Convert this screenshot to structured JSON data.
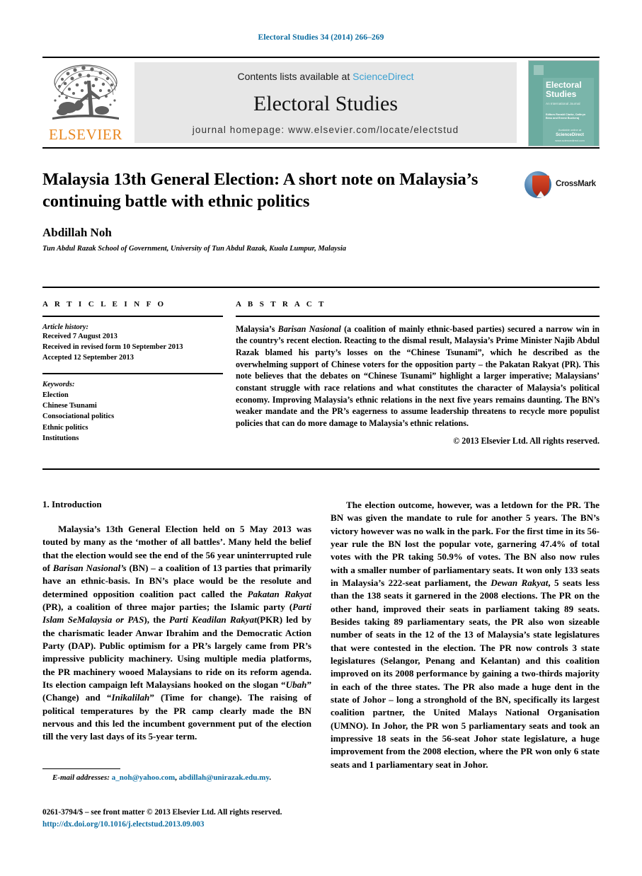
{
  "running_head": "Electoral Studies 34 (2014) 266–269",
  "masthead": {
    "publisher_name": "ELSEVIER",
    "contents_prefix": "Contents lists available at ",
    "contents_link": "ScienceDirect",
    "journal_title": "Electoral Studies",
    "homepage_label": "journal homepage: www.elsevier.com/locate/electstud",
    "cover": {
      "title_line1": "Electoral",
      "title_line2": "Studies",
      "subtitle": "An International Journal",
      "editors": "Editors\nRonald Clarke, Cathryn Bess and Ernest Bucheraj",
      "sd_small": "Available online at",
      "sd_name": "ScienceDirect",
      "sd_foot": "www.sciencedirect.com"
    },
    "accent_color": "#3aa0d1",
    "elsevier_orange": "#e8861e",
    "cover_teal": "#6bab9f"
  },
  "title_block": {
    "title": "Malaysia 13th General Election: A short note on Malaysia’s continuing battle with ethnic politics",
    "crossmark_label": "CrossMark",
    "author": "Abdillah Noh",
    "affiliation": "Tun Abdul Razak School of Government, University of Tun Abdul Razak, Kuala Lumpur, Malaysia"
  },
  "article_info": {
    "heading": "A R T I C L E   I N F O",
    "history_label": "Article history:",
    "history": [
      "Received 7 August 2013",
      "Received in revised form 10 September 2013",
      "Accepted 12 September 2013"
    ],
    "keywords_label": "Keywords:",
    "keywords": [
      "Election",
      "Chinese Tsunami",
      "Consociational politics",
      "Ethnic politics",
      "Institutions"
    ]
  },
  "abstract": {
    "heading": "A B S T R A C T",
    "text_html": "Malaysia’s <em>Barisan Nasional</em> (a coalition of mainly ethnic-based parties) secured a narrow win in the country’s recent election. Reacting to the dismal result, Malaysia’s Prime Minister Najib Abdul Razak blamed his party’s losses on the “Chinese Tsunami”, which he described as the overwhelming support of Chinese voters for the opposition party – the Pakatan Rakyat (PR). This note believes that the debates on “Chinese Tsunami” highlight a larger imperative; Malaysians’ constant struggle with race relations and what constitutes the character of Malaysia’s political economy. Improving Malaysia’s ethnic relations in the next five years remains daunting. The BN’s weaker mandate and the PR’s eagerness to assume leadership threatens to recycle more populist policies that can do more damage to Malaysia’s ethnic relations.",
    "copyright": "© 2013 Elsevier Ltd. All rights reserved."
  },
  "body": {
    "section_heading": "1. Introduction",
    "left_paragraph_html": "Malaysia’s 13th General Election held on 5 May 2013 was touted by many as the ‘mother of all battles’. Many held the belief that the election would see the end of the 56 year uninterrupted rule of <em>Barisan Nasional’s</em> (BN) – a coalition of 13 parties that primarily have an ethnic-basis. In BN’s place would be the resolute and determined opposition coalition pact called the <em>Pakatan Rakyat</em> (PR), a coalition of three major parties; the Islamic party (<em>Parti Islam SeMalaysia or PAS</em>), the <em>Parti Keadilan Rakyat</em>(PKR) led by the charismatic leader Anwar Ibrahim and the Democratic Action Party (DAP). Public optimism for a PR’s largely came from PR’s impressive publicity machinery. Using multiple media platforms, the PR machinery wooed Malaysians to ride on its reform agenda. Its election campaign left Malaysians hooked on the slogan “<em>Ubah</em>” (Change) and “<em>Inikalilah</em>” (Time for change). The raising of political temperatures by the PR camp clearly made the BN nervous and this led the incumbent government put of the election till the very last days of its 5-year term.",
    "right_paragraph_html": "The election outcome, however, was a letdown for the PR. The BN was given the mandate to rule for another 5 years. The BN’s victory however was no walk in the park. For the first time in its 56-year rule the BN lost the popular vote, garnering 47.4% of total votes with the PR taking 50.9% of votes. The BN also now rules with a smaller number of parliamentary seats. It won only 133 seats in Malaysia’s 222-seat parliament, the <em>Dewan Rakyat</em>, 5 seats less than the 138 seats it garnered in the 2008 elections. The PR on the other hand, improved their seats in parliament taking 89 seats. Besides taking 89 parliamentary seats, the PR also won sizeable number of seats in the 12 of the 13 of Malaysia’s state legislatures that were contested in the election. The PR now controls 3 state legislatures (Selangor, Penang and Kelantan) and this coalition improved on its 2008 performance by gaining a two-thirds majority in each of the three states. The PR also made a huge dent in the state of Johor – long a stronghold of the BN, specifically its largest coalition partner, the United Malays National Organisation (UMNO). In Johor, the PR won 5 parliamentary seats and took an impressive 18 seats in the 56-seat Johor state legislature, a huge improvement from the 2008 election, where the PR won only 6 state seats and 1 parliamentary seat in Johor."
  },
  "footer": {
    "email_label": "E-mail addresses:",
    "email_1": "a_noh@yahoo.com",
    "email_sep": ", ",
    "email_2": "abdillah@unirazak.edu.my",
    "email_end": ".",
    "front_matter": "0261-3794/$ – see front matter © 2013 Elsevier Ltd. All rights reserved.",
    "doi": "http://dx.doi.org/10.1016/j.electstud.2013.09.003",
    "link_color": "#0b6ca0"
  }
}
